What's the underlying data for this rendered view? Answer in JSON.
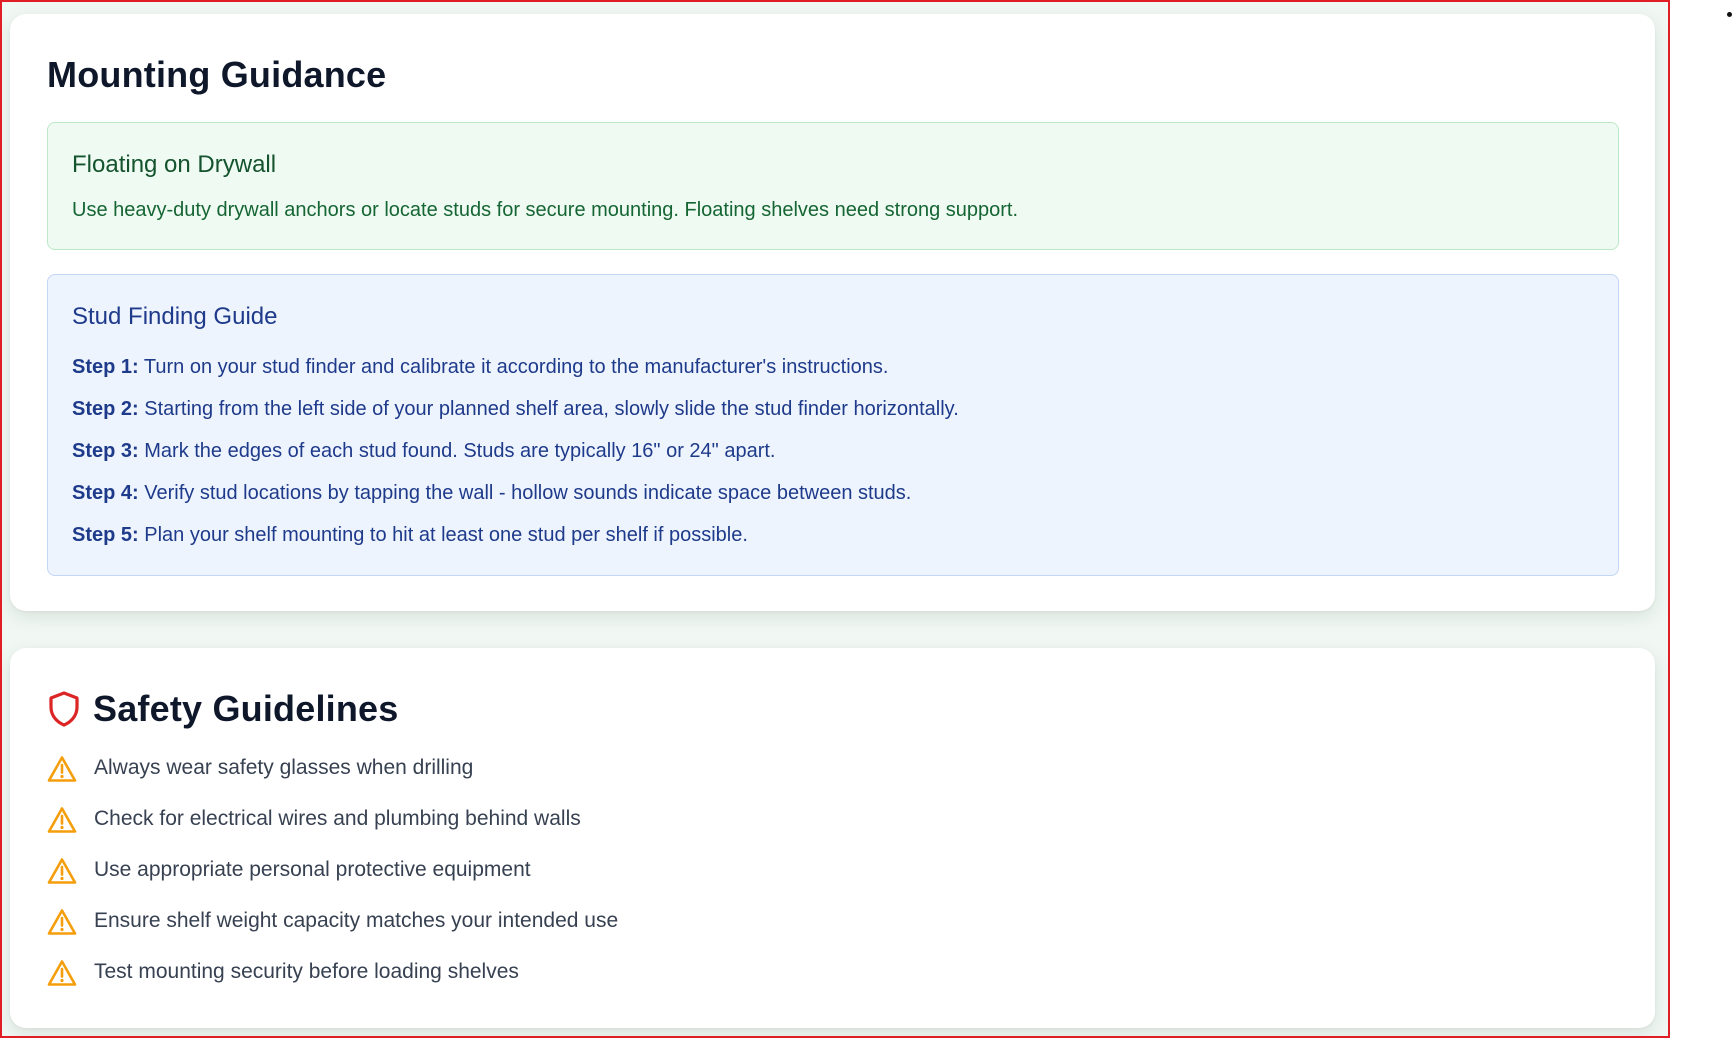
{
  "mounting": {
    "title": "Mounting Guidance",
    "drywall": {
      "title": "Floating on Drywall",
      "text": "Use heavy-duty drywall anchors or locate studs for secure mounting. Floating shelves need strong support."
    },
    "stud_guide": {
      "title": "Stud Finding Guide",
      "steps": [
        {
          "label": "Step 1:",
          "text": " Turn on your stud finder and calibrate it according to the manufacturer's instructions."
        },
        {
          "label": "Step 2:",
          "text": " Starting from the left side of your planned shelf area, slowly slide the stud finder horizontally."
        },
        {
          "label": "Step 3:",
          "text": " Mark the edges of each stud found. Studs are typically 16\" or 24\" apart."
        },
        {
          "label": "Step 4:",
          "text": " Verify stud locations by tapping the wall - hollow sounds indicate space between studs."
        },
        {
          "label": "Step 5:",
          "text": " Plan your shelf mounting to hit at least one stud per shelf if possible."
        }
      ]
    }
  },
  "safety": {
    "title": "Safety Guidelines",
    "icon": "shield-icon",
    "item_icon": "warning-icon",
    "items": [
      "Always wear safety glasses when drilling",
      "Check for electrical wires and plumbing behind walls",
      "Use appropriate personal protective equipment",
      "Ensure shelf weight capacity matches your intended use",
      "Test mounting security before loading shelves"
    ]
  },
  "colors": {
    "frame_border": "#e11d25",
    "green_panel_bg": "#effbf2",
    "green_panel_text": "#166534",
    "blue_panel_bg": "#eef4fe",
    "blue_panel_text": "#1e3a8a",
    "shield": "#dc2626",
    "warning": "#f59e0b"
  }
}
